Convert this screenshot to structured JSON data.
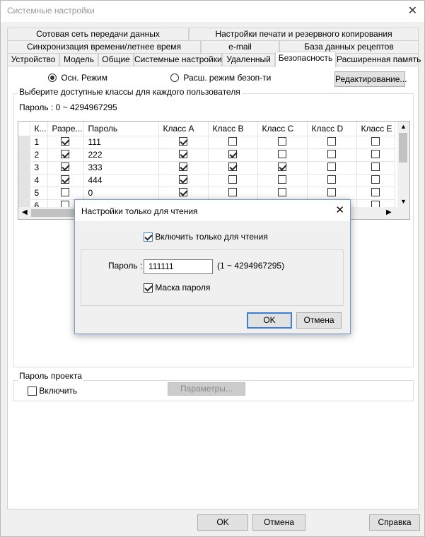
{
  "window": {
    "title": "Системные настройки",
    "close": "✕"
  },
  "tabs": {
    "row1": [
      "Сотовая сеть передачи данных",
      "Настройки печати и резервного копирования"
    ],
    "row2": [
      "Синхронизация времени/летнее время",
      "e-mail",
      "База данных рецептов"
    ],
    "row3": [
      "Устройство",
      "Модель",
      "Общие",
      "Системные настройки",
      "Удаленный",
      "Безопасность",
      "Расширенная память"
    ],
    "active": "Безопасность"
  },
  "security": {
    "mode_basic": "Осн. Режим",
    "mode_extended": "Расш. режим безоп-ти",
    "selected_mode": "basic",
    "edit_button": "Редактирование...",
    "group_label": "Выберите доступные классы для каждого пользователя",
    "password_range": "Пароль : 0 ~ 4294967295",
    "table": {
      "headers": [
        "К...",
        "Разре...",
        "Пароль",
        "Класс A",
        "Класс B",
        "Класс C",
        "Класс D",
        "Класс E"
      ],
      "rows": [
        {
          "k": "1",
          "allow": true,
          "pwd": "111",
          "a": true,
          "b": false,
          "c": false,
          "d": false,
          "e": false
        },
        {
          "k": "2",
          "allow": true,
          "pwd": "222",
          "a": true,
          "b": true,
          "c": false,
          "d": false,
          "e": false
        },
        {
          "k": "3",
          "allow": true,
          "pwd": "333",
          "a": true,
          "b": true,
          "c": true,
          "d": false,
          "e": false
        },
        {
          "k": "4",
          "allow": true,
          "pwd": "444",
          "a": true,
          "b": false,
          "c": false,
          "d": false,
          "e": false
        },
        {
          "k": "5",
          "allow": false,
          "pwd": "0",
          "a": true,
          "b": false,
          "c": false,
          "d": false,
          "e": false
        },
        {
          "k": "6",
          "allow": false,
          "pwd": "0",
          "a": false,
          "b": false,
          "c": false,
          "d": false,
          "e": false
        }
      ]
    },
    "project_password": {
      "label": "Пароль проекта",
      "enable_label": "Включить",
      "enabled": false,
      "params_button": "Параметры..."
    }
  },
  "dialog": {
    "title": "Настройки только для чтения",
    "close": "✕",
    "enable_readonly_label": "Включить только для чтения",
    "enable_readonly": true,
    "password_label": "Пароль :",
    "password_value": "111111",
    "password_range": "(1 ~ 4294967295)",
    "mask_label": "Маска пароля",
    "mask": true,
    "ok": "OK",
    "cancel": "Отмена"
  },
  "footer": {
    "ok": "OK",
    "cancel": "Отмена",
    "help": "Справка"
  }
}
